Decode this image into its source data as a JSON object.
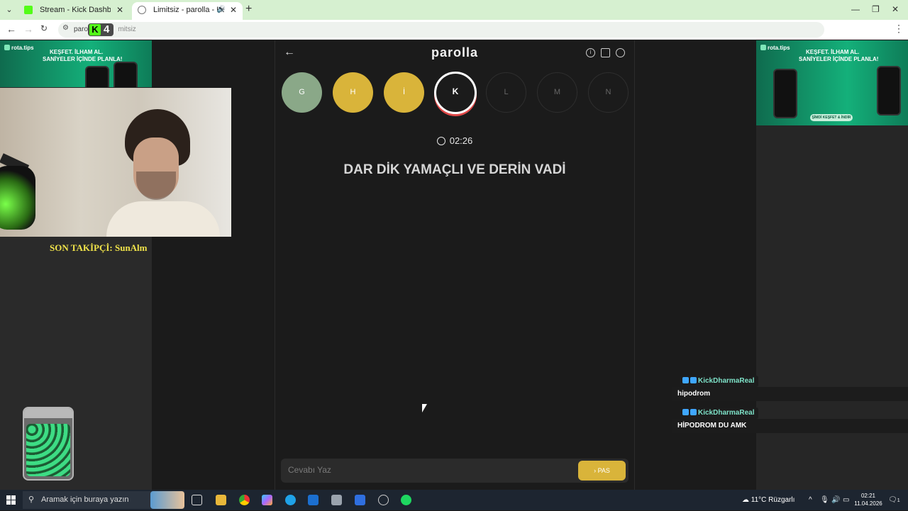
{
  "browser": {
    "tabs": [
      {
        "title": "Stream - Kick Dashboard"
      },
      {
        "title": "Limitsiz - parolla - Kelime o"
      }
    ],
    "new_tab": "+",
    "url_main": "parol",
    "url_tail": "mitsiz",
    "kick_badge_count": "4",
    "colors": {
      "kick_green": "#53fc18"
    }
  },
  "stream_overlay": {
    "ad_brand": "rota.tips",
    "ad_line1": "KEŞFET. İLHAM AL.",
    "ad_line2": "SANİYELER İÇİNDE PLANLA!",
    "ad_cta": "ŞİMDİ KEŞFET & İNDİR",
    "follower_text": "SON TAKİPÇİ: SunAlm"
  },
  "game": {
    "title": "parolla",
    "letters": [
      {
        "char": "G",
        "state": "done"
      },
      {
        "char": "H",
        "state": "pass"
      },
      {
        "char": "İ",
        "state": "pass"
      },
      {
        "char": "K",
        "state": "active"
      },
      {
        "char": "L",
        "state": "todo"
      },
      {
        "char": "M",
        "state": "todo"
      },
      {
        "char": "N",
        "state": "todo"
      }
    ],
    "timer": "02:26",
    "question": "DAR DİK YAMAÇLI VE DERİN VADİ",
    "answer_placeholder": "Cevabı Yaz",
    "pass_label": "PAS",
    "colors": {
      "done": "#8aa888",
      "pass": "#d9b43a",
      "active_ring": "#e04848"
    }
  },
  "chat": [
    {
      "user": "KickDharmaReal",
      "message": "hipodrom"
    },
    {
      "user": "KickDharmaReal",
      "message": "HİPODROM DU AMK"
    }
  ],
  "taskbar": {
    "search_placeholder": "Aramak için buraya yazın",
    "weather": "11°C  Rüzgarlı",
    "time": "02:21",
    "date": "11.04.2026",
    "notifications": "1"
  }
}
